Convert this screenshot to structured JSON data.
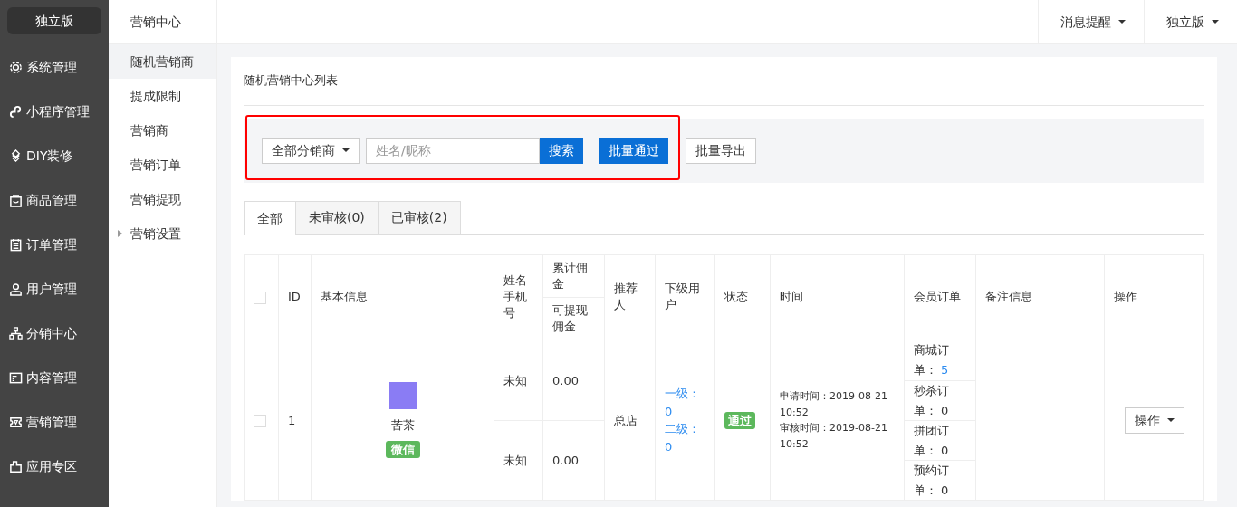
{
  "brand": "独立版",
  "nav": [
    {
      "label": "系统管理",
      "selected": false
    },
    {
      "label": "小程序管理",
      "selected": false
    },
    {
      "label": "DIY装修",
      "selected": false
    },
    {
      "label": "商品管理",
      "selected": false
    },
    {
      "label": "订单管理",
      "selected": false
    },
    {
      "label": "用户管理",
      "selected": false
    },
    {
      "label": "分销中心",
      "selected": false
    },
    {
      "label": "内容管理",
      "selected": false
    },
    {
      "label": "营销管理",
      "selected": false
    },
    {
      "label": "应用专区",
      "selected": false
    }
  ],
  "subnav": {
    "title": "营销中心",
    "items": [
      {
        "label": "随机营销商",
        "selected": true,
        "kind": "link"
      },
      {
        "label": "提成限制",
        "selected": false,
        "kind": "link"
      },
      {
        "label": "营销商",
        "selected": false,
        "kind": "link"
      },
      {
        "label": "营销订单",
        "selected": false,
        "kind": "link"
      },
      {
        "label": "营销提现",
        "selected": false,
        "kind": "link"
      },
      {
        "label": "营销设置",
        "selected": false,
        "kind": "group"
      }
    ]
  },
  "topbar": {
    "menus": [
      "消息提醒",
      "独立版"
    ]
  },
  "panel": {
    "title": "随机营销中心列表",
    "filter": {
      "dropdown": "全部分销商",
      "placeholder": "姓名/昵称",
      "search_button": "搜索",
      "buttons": [
        {
          "label": "批量通过",
          "kind": "primary"
        },
        {
          "label": "批量导出",
          "kind": "default"
        }
      ]
    },
    "tabs": [
      {
        "label": "全部",
        "selected": true
      },
      {
        "label": "未审核(0)",
        "selected": false
      },
      {
        "label": "已审核(2)",
        "selected": false
      }
    ],
    "table": {
      "select_all_checked": false,
      "columns": {
        "id": "ID",
        "info": "基本信息",
        "name": "姓名手机号",
        "commission_total": "累计佣金",
        "commission_withdrawable": "可提现佣金",
        "referrer": "推荐人",
        "subordinates": "下级用户",
        "status": "状态",
        "time": "时间",
        "orders": "会员订单",
        "remark": "备注信息",
        "action": "操作"
      },
      "rows": [
        {
          "checked": false,
          "id": "1",
          "nickname": "苦茶",
          "platform": "微信",
          "entries": [
            {
              "name": "未知",
              "commission": "0.00"
            },
            {
              "name": "未知",
              "commission": "0.00"
            }
          ],
          "referrer": "总店",
          "subordinates": [
            "一级：0",
            "二级：0"
          ],
          "status": "通过",
          "times": [
            "申请时间：2019-08-21 10:52",
            "审核时间：2019-08-21 10:52"
          ],
          "orders": [
            {
              "label": "商城订单：",
              "count": "5",
              "linked": true
            },
            {
              "label": "秒杀订单：",
              "count": "0",
              "linked": false
            },
            {
              "label": "拼团订单：",
              "count": "0",
              "linked": false
            },
            {
              "label": "预约订单：",
              "count": "0",
              "linked": false
            }
          ],
          "action": "操作"
        }
      ]
    }
  }
}
